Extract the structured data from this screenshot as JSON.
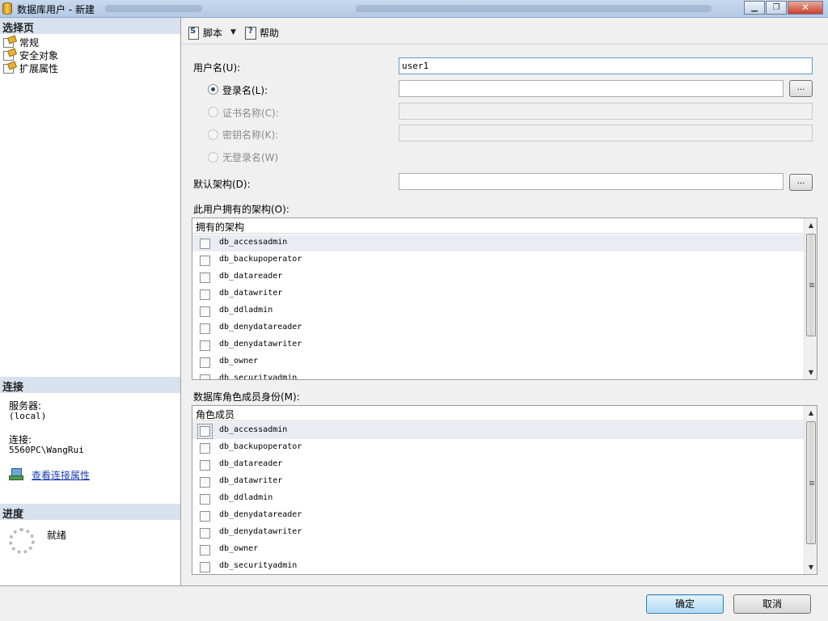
{
  "window": {
    "title": "数据库用户 - 新建",
    "minimize": "▁",
    "maximize": "❐",
    "close": "✕"
  },
  "left": {
    "select_page_header": "选择页",
    "pages": [
      {
        "label": "常规",
        "icon": "page-icon"
      },
      {
        "label": "安全对象",
        "icon": "page-icon"
      },
      {
        "label": "扩展属性",
        "icon": "page-icon"
      }
    ],
    "connection_header": "连接",
    "server_label": "服务器:",
    "server_value": "(local)",
    "connection_label": "连接:",
    "connection_value": "5560PC\\WangRui",
    "view_connection_properties": "查看连接属性",
    "progress_header": "进度",
    "progress_status": "就绪"
  },
  "toolbar": {
    "script_label": "脚本",
    "help_label": "帮助"
  },
  "form": {
    "username_label": "用户名(U):",
    "username_value": "user1",
    "login_name_label": "登录名(L):",
    "login_name_value": "",
    "certificate_label": "证书名称(C):",
    "key_label": "密钥名称(K):",
    "no_login_label": "无登录名(W)",
    "default_schema_label": "默认架构(D):",
    "default_schema_value": "",
    "browse_label": "...",
    "owned_schemas_label": "此用户拥有的架构(O):",
    "owned_schemas_header": "拥有的架构",
    "owned_schemas": [
      "db_accessadmin",
      "db_backupoperator",
      "db_datareader",
      "db_datawriter",
      "db_ddladmin",
      "db_denydatareader",
      "db_denydatawriter",
      "db_owner",
      "db_securityadmin"
    ],
    "role_membership_label": "数据库角色成员身份(M):",
    "role_membership_header": "角色成员",
    "roles": [
      "db_accessadmin",
      "db_backupoperator",
      "db_datareader",
      "db_datawriter",
      "db_ddladmin",
      "db_denydatareader",
      "db_denydatawriter",
      "db_owner",
      "db_securityadmin"
    ]
  },
  "buttons": {
    "ok": "确定",
    "cancel": "取消"
  },
  "colors": {
    "section_header": "#d8e1ee",
    "link": "#1a3db5",
    "selected_row": "#e9edf3"
  }
}
